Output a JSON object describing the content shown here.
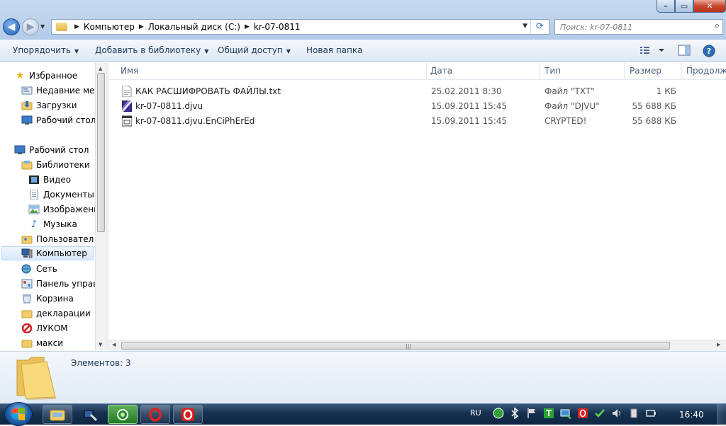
{
  "window": {
    "controls": {
      "minimize": "–",
      "maximize": "▭",
      "close": "✕"
    }
  },
  "nav_buttons": {
    "back": "◀",
    "forward": "▶"
  },
  "address": {
    "crumbs": [
      "Компьютер",
      "Локальный диск (C:)",
      "kr-07-0811"
    ]
  },
  "search": {
    "placeholder": "Поиск: kr-07-0811"
  },
  "toolbar": {
    "organize": "Упорядочить",
    "add_to_library": "Добавить в библиотеку",
    "share": "Общий доступ",
    "new_folder": "Новая папка"
  },
  "sidebar": {
    "items": [
      {
        "label": "Избранное",
        "icon": "star-icon"
      },
      {
        "label": "Недавние мест",
        "icon": "recent-places-icon"
      },
      {
        "label": "Загрузки",
        "icon": "downloads-icon"
      },
      {
        "label": "Рабочий стол",
        "icon": "desktop-icon"
      },
      {
        "label": "Рабочий стол",
        "icon": "desktop-icon"
      },
      {
        "label": "Библиотеки",
        "icon": "libraries-icon"
      },
      {
        "label": "Видео",
        "icon": "video-icon"
      },
      {
        "label": "Документы",
        "icon": "documents-icon"
      },
      {
        "label": "Изображени",
        "icon": "pictures-icon"
      },
      {
        "label": "Музыка",
        "icon": "music-icon"
      },
      {
        "label": "Пользовател",
        "icon": "user-folder-icon"
      },
      {
        "label": "Компьютер",
        "icon": "computer-icon"
      },
      {
        "label": "Сеть",
        "icon": "network-icon"
      },
      {
        "label": "Панель управл",
        "icon": "control-panel-icon"
      },
      {
        "label": "Корзина",
        "icon": "recycle-bin-icon"
      },
      {
        "label": "декларации",
        "icon": "folder-icon"
      },
      {
        "label": "ЛУКОМ",
        "icon": "opera-icon"
      },
      {
        "label": "макси",
        "icon": "folder-icon"
      }
    ]
  },
  "columns": {
    "name": "Имя",
    "date": "Дата",
    "type": "Тип",
    "size": "Размер",
    "duration": "Продолжи"
  },
  "files": [
    {
      "name": "КАК РАСШИФРОВАТЬ ФАЙЛЫ.txt",
      "date": "25.02.2011 8:30",
      "type": "Файл \"TXT\"",
      "size": "1 КБ",
      "icon": "text-file-icon"
    },
    {
      "name": "kr-07-0811.djvu",
      "date": "15.09.2011 15:45",
      "type": "Файл \"DJVU\"",
      "size": "55 688 КБ",
      "icon": "djvu-file-icon"
    },
    {
      "name": "kr-07-0811.djvu.EnCiPhErEd",
      "date": "15.09.2011 15:45",
      "type": "CRYPTED!",
      "size": "55 688 КБ",
      "icon": "unknown-file-icon"
    }
  ],
  "details": {
    "items_count": "Элементов: 3"
  },
  "taskbar": {
    "language": "RU",
    "time": "16:40"
  },
  "colors": {
    "selection": "#d9e8fb",
    "taskbar": "#16304f",
    "toolbar_text": "#1e395b"
  }
}
